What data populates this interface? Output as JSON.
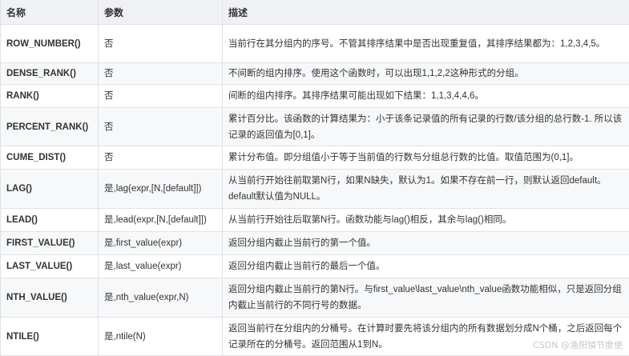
{
  "table": {
    "headers": [
      "名称",
      "参数",
      "描述"
    ],
    "rows": [
      {
        "name": "ROW_NUMBER()",
        "param": "否",
        "desc": "当前行在其分组内的序号。不管其排序结果中是否出现重复值，其排序结果都为：1,2,3,4,5。"
      },
      {
        "name": "DENSE_RANK()",
        "param": "否",
        "desc": "不间断的组内排序。使用这个函数时，可以出现1,1,2,2这种形式的分组。"
      },
      {
        "name": "RANK()",
        "param": "否",
        "desc": "间断的组内排序。其排序结果可能出现如下结果：1,1,3,4,4,6。"
      },
      {
        "name": "PERCENT_RANK()",
        "param": "否",
        "desc": "累计百分比。该函数的计算结果为：小于该条记录值的所有记录的行数/该分组的总行数-1. 所以该记录的返回值为[0,1]。"
      },
      {
        "name": "CUME_DIST()",
        "param": "否",
        "desc": "累计分布值。即分组值小于等于当前值的行数与分组总行数的比值。取值范围为(0,1]。"
      },
      {
        "name": "LAG()",
        "param": "是,lag(expr,[N,[default]])",
        "desc": "从当前行开始往前取第N行，如果N缺失，默认为1。如果不存在前一行，则默认返回default。default默认值为NULL。"
      },
      {
        "name": "LEAD()",
        "param": "是,lead(expr,[N,[default]])",
        "desc": "从当前行开始往后取第N行。函数功能与lag()相反，其余与lag()相同。"
      },
      {
        "name": "FIRST_VALUE()",
        "param": "是,first_value(expr)",
        "desc": "返回分组内截止当前行的第一个值。"
      },
      {
        "name": "LAST_VALUE()",
        "param": "是,last_value(expr)",
        "desc": "返回分组内截止当前行的最后一个值。"
      },
      {
        "name": "NTH_VALUE()",
        "param": "是,nth_value(expr,N)",
        "desc": "返回分组内截止当前行的第N行。与first_value\\last_value\\nth_value函数功能相似，只是返回分组内截止当前行的不同行号的数据。"
      },
      {
        "name": "NTILE()",
        "param": "是,ntile(N)",
        "desc": "返回当前行在分组内的分桶号。在计算时要先将该分组内的所有数据划分成N个桶，之后返回每个记录所在的分桶号。返回范围从1到N。"
      }
    ]
  },
  "watermark": "CSDN @渔阳镇节度使"
}
